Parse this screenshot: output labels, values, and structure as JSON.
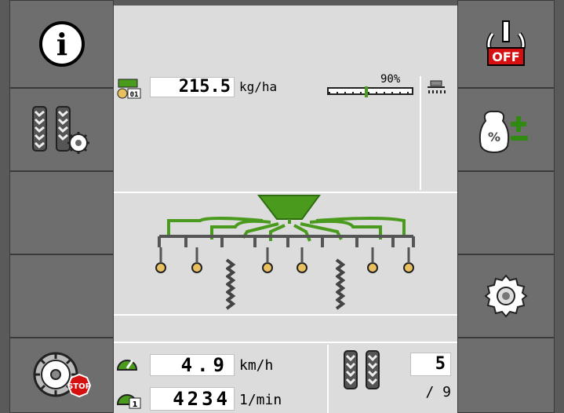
{
  "left_softkeys": [
    {
      "name": "info-button",
      "icon": "info-icon"
    },
    {
      "name": "section-settings-button",
      "icon": "tyres-gear-icon"
    },
    {
      "name": "empty-softkey-3",
      "icon": ""
    },
    {
      "name": "empty-softkey-4",
      "icon": ""
    },
    {
      "name": "stop-wheel-button",
      "icon": "wheel-stop-icon"
    }
  ],
  "right_softkeys": [
    {
      "name": "power-off-button",
      "icon": "power-off-icon",
      "badge": "OFF"
    },
    {
      "name": "rate-adjust-button",
      "icon": "bag-percent-plusminus-icon"
    },
    {
      "name": "empty-softkey-r3",
      "icon": ""
    },
    {
      "name": "settings-button",
      "icon": "gear-icon"
    },
    {
      "name": "empty-softkey-r5",
      "icon": ""
    }
  ],
  "rate": {
    "value": "215.5",
    "unit": "kg/ha",
    "product_index": "01"
  },
  "fill_level": {
    "label": "90%",
    "fraction": 0.9
  },
  "speed": {
    "value": "4.9",
    "unit": "km/h"
  },
  "rpm": {
    "value": "4234",
    "unit": "1/min"
  },
  "tramline": {
    "current": "5",
    "total": "/ 9"
  },
  "colors": {
    "accent_green": "#4a9a1e",
    "dark_green": "#2e6e10",
    "panel": "#6e6e6e",
    "screen": "#dcdcdc",
    "off_red": "#d41010"
  }
}
